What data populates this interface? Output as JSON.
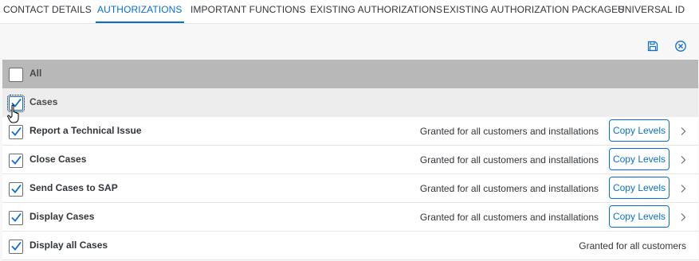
{
  "tabs": [
    {
      "label": "CONTACT DETAILS",
      "active": false
    },
    {
      "label": "AUTHORIZATIONS",
      "active": true
    },
    {
      "label": "IMPORTANT FUNCTIONS",
      "active": false
    },
    {
      "label": "EXISTING AUTHORIZATIONS",
      "active": false
    },
    {
      "label": "EXISTING AUTHORIZATION PACKAGES",
      "active": false
    },
    {
      "label": "UNIVERSAL ID",
      "active": false
    }
  ],
  "toolbar": {
    "save_icon": "save-icon",
    "cancel_icon": "cancel-icon"
  },
  "table": {
    "header": {
      "label": "All",
      "checked": false
    },
    "group": {
      "label": "Cases",
      "checked": true
    },
    "rows": [
      {
        "label": "Report a Technical Issue",
        "status": "Granted for all customers and installations",
        "button": "Copy Levels",
        "checked": true
      },
      {
        "label": "Close Cases",
        "status": "Granted for all customers and installations",
        "button": "Copy Levels",
        "checked": true
      },
      {
        "label": "Send Cases to SAP",
        "status": "Granted for all customers and installations",
        "button": "Copy Levels",
        "checked": true
      },
      {
        "label": "Display Cases",
        "status": "Granted for all customers and installations",
        "button": "Copy Levels",
        "checked": true
      },
      {
        "label": "Display all Cases",
        "status": "Granted for all customers",
        "button": "",
        "checked": true
      }
    ]
  },
  "colors": {
    "accent": "#0a6ed1",
    "header_bg": "#b8b8b8",
    "group_bg": "#ededed"
  }
}
